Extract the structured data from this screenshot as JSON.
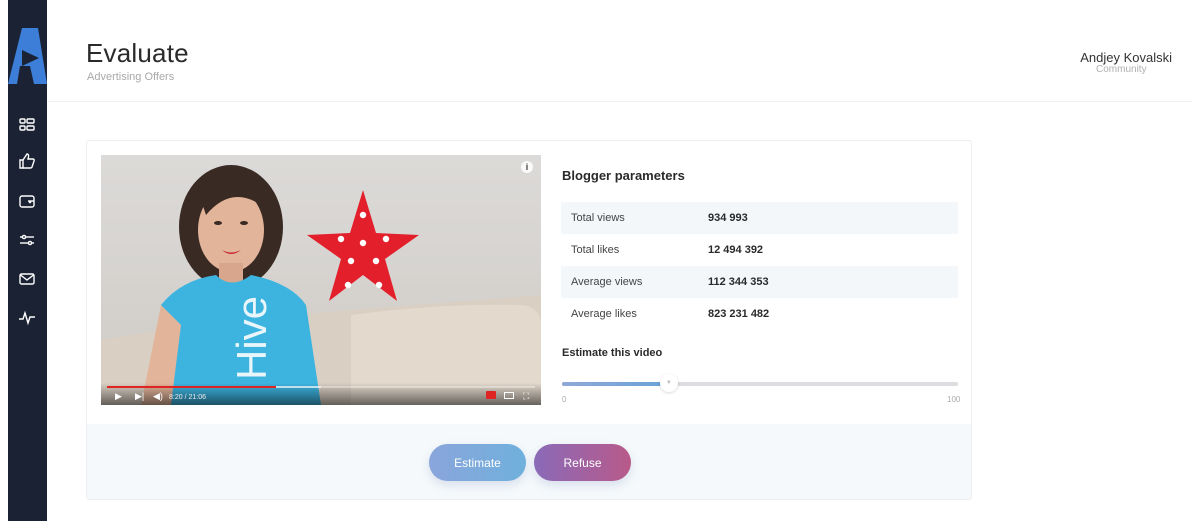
{
  "header": {
    "title": "Evaluate",
    "subtitle": "Advertising Offers"
  },
  "user": {
    "name": "Andjey Kovalski",
    "role": "Community"
  },
  "sidebar": {
    "items": [
      {
        "icon": "dashboard-icon"
      },
      {
        "icon": "thumbs-up-icon"
      },
      {
        "icon": "wallet-icon"
      },
      {
        "icon": "sliders-icon"
      },
      {
        "icon": "mail-icon"
      },
      {
        "icon": "activity-icon"
      }
    ]
  },
  "video": {
    "time": "8:20 / 21:06",
    "progress": 0.395,
    "buffered": 0.5
  },
  "params": {
    "title": "Blogger parameters",
    "rows": [
      {
        "label": "Total views",
        "value": "934 993"
      },
      {
        "label": "Total likes",
        "value": "12 494 392"
      },
      {
        "label": "Average views",
        "value": "112 344 353"
      },
      {
        "label": "Average likes",
        "value": "823 231 482"
      }
    ]
  },
  "estimate": {
    "title": "Estimate this video",
    "min": "0",
    "max": "100",
    "value": 27
  },
  "actions": {
    "estimate_label": "Estimate",
    "refuse_label": "Refuse"
  },
  "colors": {
    "sidebar": "#1a2233",
    "accent_blue": "#6fb0dc",
    "accent_purple": "#8a6ab8"
  }
}
